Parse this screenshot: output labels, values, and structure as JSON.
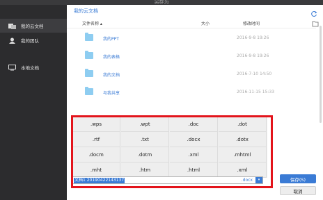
{
  "window": {
    "title": "另存为"
  },
  "sidebar": {
    "items": [
      {
        "label": "我的云文档",
        "icon": "cloud-docs-icon"
      },
      {
        "label": "我的团队",
        "icon": "team-icon"
      },
      {
        "label": "本地文档",
        "icon": "monitor-icon"
      }
    ]
  },
  "main": {
    "breadcrumb": "我的云文档",
    "columns": {
      "name": "文件名称 ▴",
      "size": "大小",
      "modified": "修改时间"
    },
    "rows": [
      {
        "name": "我的PPT",
        "date": "2016-9-8 19:26"
      },
      {
        "name": "我的表格",
        "date": "2016-9-8 19:26"
      },
      {
        "name": "我的文档",
        "date": "2016-7-10 14:50"
      },
      {
        "name": "与我共享",
        "date": "2016-11-15 15:33"
      }
    ]
  },
  "formats": [
    [
      ".wps",
      ".wpt",
      ".doc",
      ".dot"
    ],
    [
      ".rtf",
      ".txt",
      ".docx",
      ".dotx"
    ],
    [
      ".docm",
      ".dotm",
      ".xml",
      ".mhtml"
    ],
    [
      ".mht",
      ".htm",
      ".html",
      ".xml"
    ]
  ],
  "filename": {
    "value": "文档1 20190422143137",
    "ext": ".docx"
  },
  "buttons": {
    "save": "保存(S)",
    "cancel": "取消"
  },
  "colors": {
    "accent": "#3a7bd5",
    "highlight": "#e3141b",
    "folder": "#8ecdf1"
  }
}
